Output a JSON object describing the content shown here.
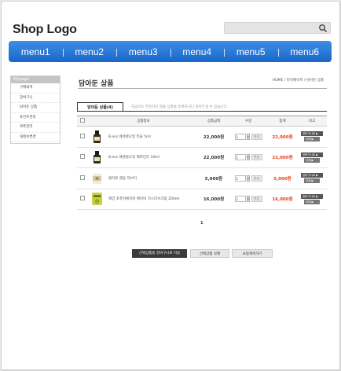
{
  "header": {
    "logo": "Shop Logo",
    "search_placeholder": ""
  },
  "nav": [
    "menu1",
    "menu2",
    "menu3",
    "menu4",
    "menu5",
    "menu6"
  ],
  "sidebar": {
    "title": "Mypage",
    "items": [
      "구매내역",
      "장바구니",
      "담아둔 상품",
      "포인트관리",
      "쿠폰관리",
      "내정보변경"
    ]
  },
  "main": {
    "title": "담아둔 상품",
    "breadcrumb": "HOME / 마이페이지 / 담아둔 상품",
    "tab": "담아둔 상품(4)",
    "tab_note": "· 지금이도 주문하지 않을 상품을 등록하거나 담아두실 수 있습니다."
  },
  "table": {
    "headers": [
      "상품정보",
      "상품금액",
      "수량",
      "합계",
      "비고"
    ],
    "rows": [
      {
        "name": "B.ess 에센셜오일 티솔 5ml",
        "price": "22,000원",
        "qty": "1",
        "total": "22,000원"
      },
      {
        "name": "B.ess 에센셜오일 페퍼민트 10ml",
        "price": "22,000원",
        "qty": "1",
        "total": "22,000원"
      },
      {
        "name": "홈타쥬 캔들 허브티",
        "price": "5,000원",
        "qty": "1",
        "total": "5,000원"
      },
      {
        "name": "해양 포퓨어에이버 베이비 코스터브크림 200ml",
        "price": "16,000원",
        "qty": "1",
        "total": "16,000원"
      }
    ],
    "change_label": "변경",
    "cart_btn": "장바구니로 ▶",
    "delete_btn": "삭제 ▶"
  },
  "pager": "1",
  "buttons": {
    "move_to_cart": "선택상품을 장바구니로 이동",
    "delete_selected": "선택상품 삭제",
    "continue_shopping": "쇼핑계속하기"
  }
}
